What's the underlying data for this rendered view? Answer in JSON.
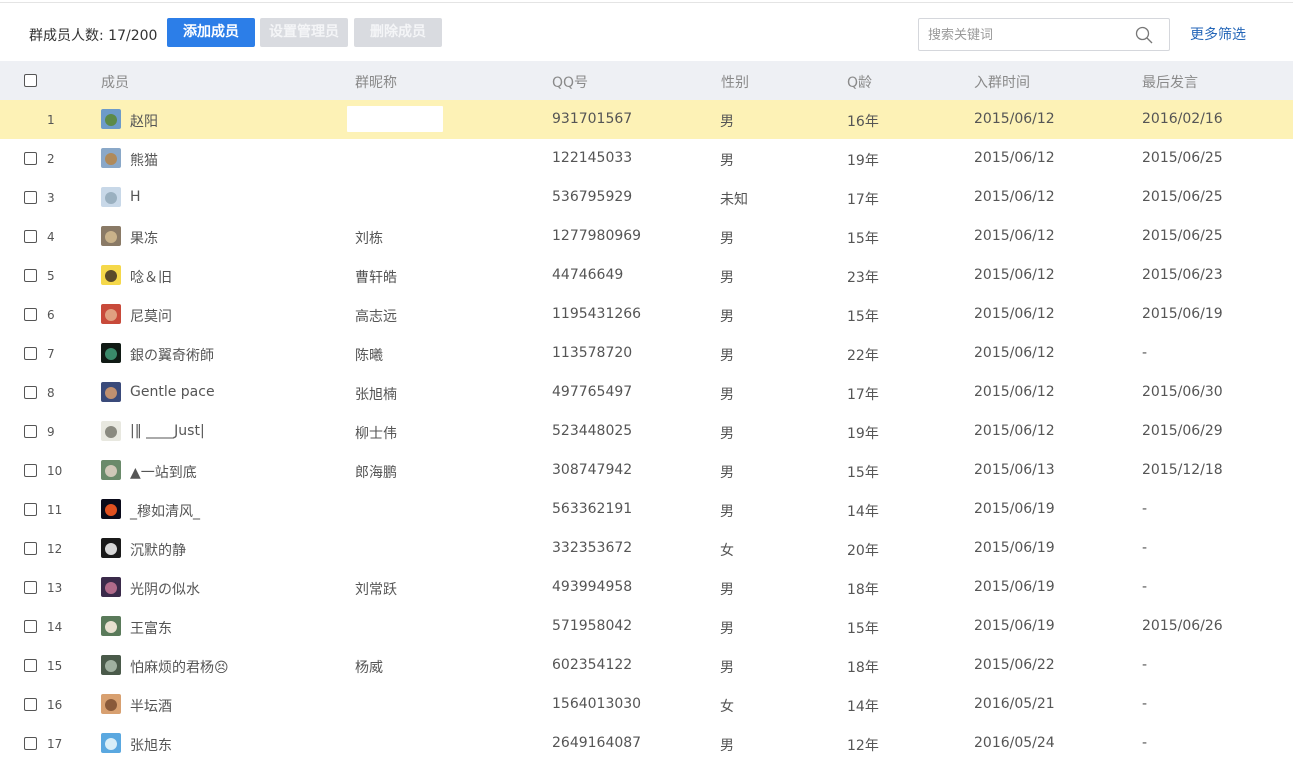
{
  "toolbar": {
    "member_count_label": "群成员人数: 17/200",
    "add_member": "添加成员",
    "set_admin": "设置管理员",
    "remove_member": "删除成员",
    "search_placeholder": "搜索关键词",
    "more_filters": "更多筛选"
  },
  "table": {
    "headers": {
      "member": "成员",
      "group_nickname": "群昵称",
      "qq": "QQ号",
      "gender": "性别",
      "q_age": "Q龄",
      "join_time": "入群时间",
      "last_post": "最后发言"
    },
    "rows": [
      {
        "index": "1",
        "member": "赵阳",
        "nickname": "",
        "qq": "931701567",
        "gender": "男",
        "q_age": "16年",
        "join": "2015/06/12",
        "last": "2016/02/16",
        "selected": true,
        "avatar": [
          "#6d9bc9",
          "#5c8a48"
        ]
      },
      {
        "index": "2",
        "member": "熊猫",
        "nickname": "",
        "qq": "122145033",
        "gender": "男",
        "q_age": "19年",
        "join": "2015/06/12",
        "last": "2015/06/25",
        "selected": false,
        "avatar": [
          "#8aa8c8",
          "#b08a5a"
        ]
      },
      {
        "index": "3",
        "member": "H",
        "nickname": "",
        "qq": "536795929",
        "gender": "未知",
        "q_age": "17年",
        "join": "2015/06/12",
        "last": "2015/06/25",
        "selected": false,
        "avatar": [
          "#c8d8e8",
          "#9ab0c0"
        ]
      },
      {
        "index": "4",
        "member": "果冻",
        "nickname": "刘栋",
        "qq": "1277980969",
        "gender": "男",
        "q_age": "15年",
        "join": "2015/06/12",
        "last": "2015/06/25",
        "selected": false,
        "avatar": [
          "#8a7a66",
          "#c9b28a"
        ]
      },
      {
        "index": "5",
        "member": "唸＆旧",
        "nickname": "曹轩皓",
        "qq": "44746649",
        "gender": "男",
        "q_age": "23年",
        "join": "2015/06/12",
        "last": "2015/06/23",
        "selected": false,
        "avatar": [
          "#f5d84a",
          "#5a4a2a"
        ]
      },
      {
        "index": "6",
        "member": "尼莫问",
        "nickname": "高志远",
        "qq": "1195431266",
        "gender": "男",
        "q_age": "15年",
        "join": "2015/06/12",
        "last": "2015/06/19",
        "selected": false,
        "avatar": [
          "#c84a3a",
          "#e0a080"
        ]
      },
      {
        "index": "7",
        "member": "銀の翼奇術師",
        "nickname": "陈曦",
        "qq": "113578720",
        "gender": "男",
        "q_age": "22年",
        "join": "2015/06/12",
        "last": "-",
        "selected": false,
        "avatar": [
          "#101a14",
          "#3a8a6a"
        ]
      },
      {
        "index": "8",
        "member": "Gentle pace",
        "nickname": "张旭楠",
        "qq": "497765497",
        "gender": "男",
        "q_age": "17年",
        "join": "2015/06/12",
        "last": "2015/06/30",
        "selected": false,
        "avatar": [
          "#3a4a7a",
          "#c09070"
        ]
      },
      {
        "index": "9",
        "member": "|‖ ____Just|",
        "nickname": "柳士伟",
        "qq": "523448025",
        "gender": "男",
        "q_age": "19年",
        "join": "2015/06/12",
        "last": "2015/06/29",
        "selected": false,
        "avatar": [
          "#e8e8e0",
          "#8a8a80"
        ]
      },
      {
        "index": "10",
        "member": "▲一站到底",
        "nickname": "郎海鹏",
        "qq": "308747942",
        "gender": "男",
        "q_age": "15年",
        "join": "2015/06/13",
        "last": "2015/12/18",
        "selected": false,
        "avatar": [
          "#6a8a6a",
          "#d0c8b8"
        ]
      },
      {
        "index": "11",
        "member": "_穆如清风_",
        "nickname": "",
        "qq": "563362191",
        "gender": "男",
        "q_age": "14年",
        "join": "2015/06/19",
        "last": "-",
        "selected": false,
        "avatar": [
          "#0a0a1a",
          "#e05020"
        ]
      },
      {
        "index": "12",
        "member": "沉默的静",
        "nickname": "",
        "qq": "332353672",
        "gender": "女",
        "q_age": "20年",
        "join": "2015/06/19",
        "last": "-",
        "selected": false,
        "avatar": [
          "#1a1a1a",
          "#d8d8d8"
        ]
      },
      {
        "index": "13",
        "member": "光阴の似水",
        "nickname": "刘常跃",
        "qq": "493994958",
        "gender": "男",
        "q_age": "18年",
        "join": "2015/06/19",
        "last": "-",
        "selected": false,
        "avatar": [
          "#3a2a4a",
          "#b06a8a"
        ]
      },
      {
        "index": "14",
        "member": "王富东",
        "nickname": "",
        "qq": "571958042",
        "gender": "男",
        "q_age": "15年",
        "join": "2015/06/19",
        "last": "2015/06/26",
        "selected": false,
        "avatar": [
          "#5a7a5a",
          "#e8e0d0"
        ]
      },
      {
        "index": "15",
        "member": "怕麻烦的君杨😣",
        "nickname": "杨威",
        "qq": "602354122",
        "gender": "男",
        "q_age": "18年",
        "join": "2015/06/22",
        "last": "-",
        "selected": false,
        "avatar": [
          "#4a5a4a",
          "#a0b0a0"
        ]
      },
      {
        "index": "16",
        "member": "半坛酒",
        "nickname": "",
        "qq": "1564013030",
        "gender": "女",
        "q_age": "14年",
        "join": "2016/05/21",
        "last": "-",
        "selected": false,
        "avatar": [
          "#d8a070",
          "#8a5a3a"
        ]
      },
      {
        "index": "17",
        "member": "张旭东",
        "nickname": "",
        "qq": "2649164087",
        "gender": "男",
        "q_age": "12年",
        "join": "2016/05/24",
        "last": "-",
        "selected": false,
        "avatar": [
          "#5aa8e0",
          "#d8eef8"
        ]
      }
    ]
  },
  "colors": {
    "primary": "#2c7ee8",
    "disabled": "#d9dbe0",
    "header_bg": "#eef0f4",
    "selected_row": "#fdf2b6",
    "link": "#2466b8"
  },
  "icons": {
    "search": "search-icon",
    "avatar": "avatar-icon"
  }
}
